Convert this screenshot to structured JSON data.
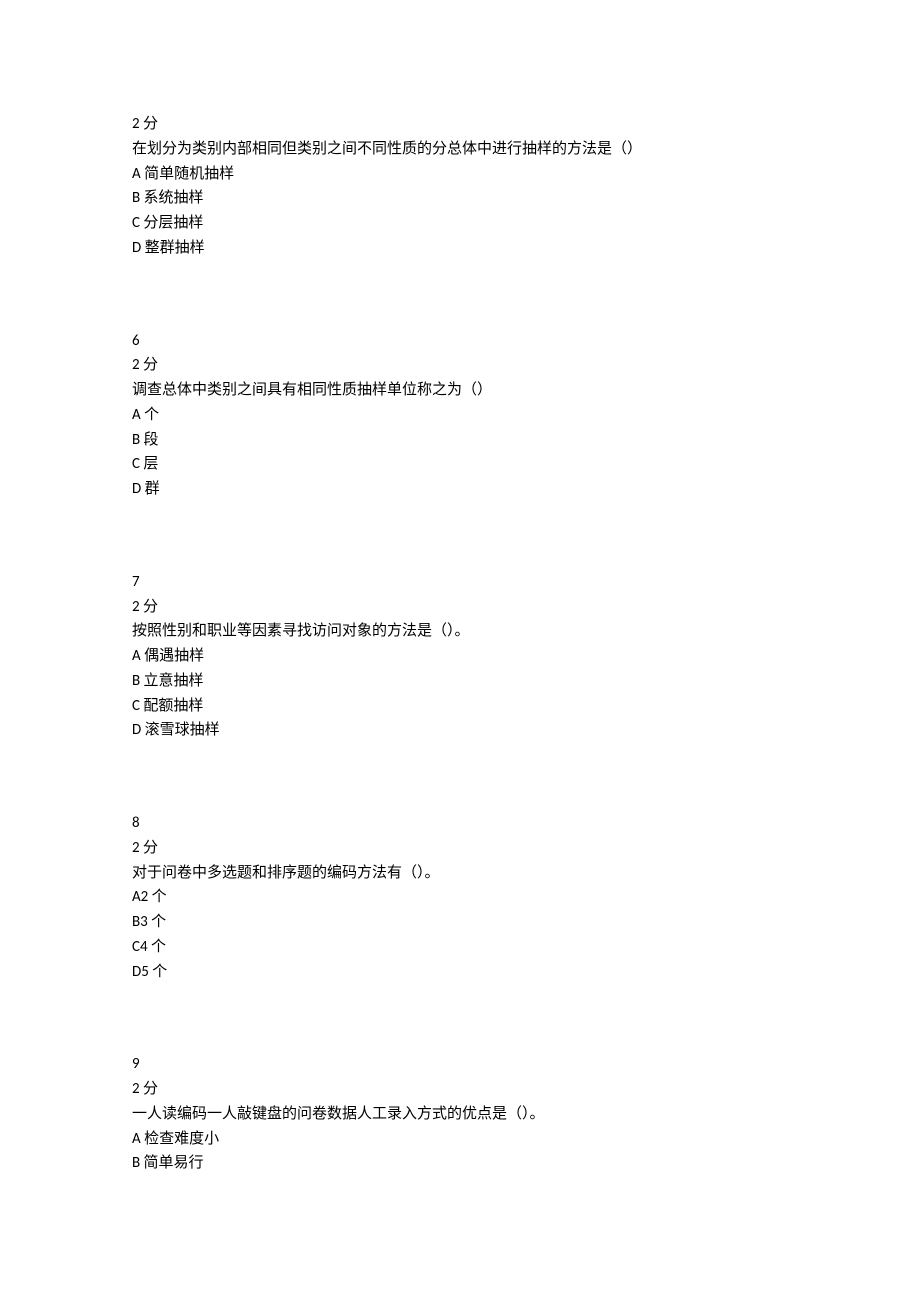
{
  "questions": [
    {
      "number": null,
      "points": "2 分",
      "stem": "在划分为类别内部相同但类别之间不同性质的分总体中进行抽样的方法是（）",
      "options": {
        "a": "A 简单随机抽样",
        "b": "B 系统抽样",
        "c": "C 分层抽样",
        "d": "D 整群抽样"
      }
    },
    {
      "number": "6",
      "points": "2 分",
      "stem": "调查总体中类别之间具有相同性质抽样单位称之为（）",
      "options": {
        "a": "A 个",
        "b": "B 段",
        "c": "C 层",
        "d": "D 群"
      }
    },
    {
      "number": "7",
      "points": "2 分",
      "stem": "按照性别和职业等因素寻找访问对象的方法是（）。",
      "options": {
        "a": "A 偶遇抽样",
        "b": "B 立意抽样",
        "c": "C 配额抽样",
        "d": "D 滚雪球抽样"
      }
    },
    {
      "number": "8",
      "points": "2 分",
      "stem": "对于问卷中多选题和排序题的编码方法有（）。",
      "options": {
        "a": "A2 个",
        "b": "B3 个",
        "c": "C4 个",
        "d": "D5 个"
      }
    },
    {
      "number": "9",
      "points": "2 分",
      "stem": "一人读编码一人敲键盘的问卷数据人工录入方式的优点是（）。",
      "options": {
        "a": "A 检查难度小",
        "b": "B 简单易行"
      }
    }
  ]
}
